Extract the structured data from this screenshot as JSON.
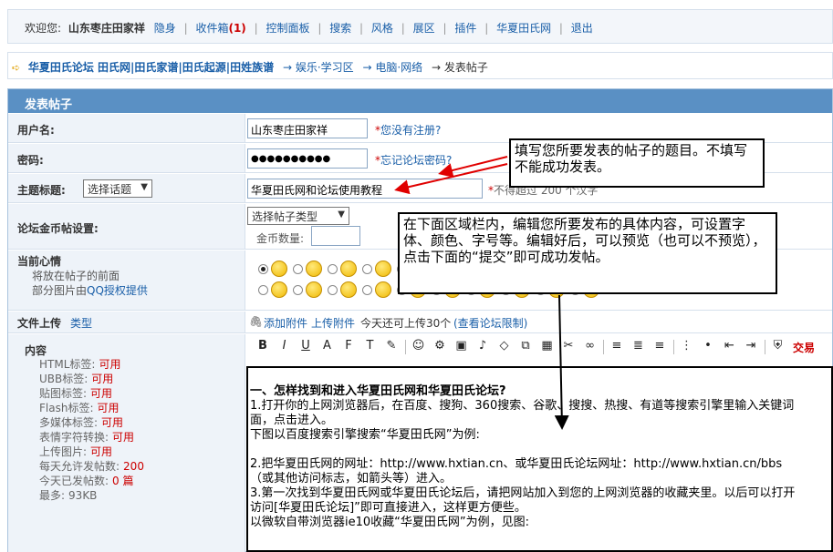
{
  "userbar": {
    "welcome": "欢迎您:",
    "username": "山东枣庄田家祥",
    "links": [
      "隐身",
      "收件箱",
      "控制面板",
      "搜索",
      "风格",
      "展区",
      "插件",
      "华夏田氏网",
      "退出"
    ],
    "inbox_count": "(1)"
  },
  "breadcrumb": {
    "forum": "华夏田氏论坛 田氏网|田氏家谱|田氏起源|田姓族谱",
    "path": [
      "→ 娱乐·学习区",
      "→ 电脑·网络",
      "→ 发表帖子"
    ]
  },
  "form": {
    "title": "发表帖子",
    "username_label": "用户名:",
    "username_value": "山东枣庄田家祥",
    "register_hint": "您没有注册?",
    "password_label": "密码:",
    "password_value": "●●●●●●●●●●",
    "forgot_hint": "忘记论坛密码?",
    "subject_label": "主题标题:",
    "topic_select": "选择话题",
    "subject_value": "华夏田氏网和论坛使用教程",
    "subject_hint": "不得超过 200 个汉字",
    "coin_label": "论坛金币帖设置:",
    "post_type_select": "选择帖子类型",
    "coin_amount_label": "金币数量:",
    "mood_label": "当前心情",
    "mood_sub1": "将放在帖子的前面",
    "mood_sub2_prefix": "部分图片由",
    "mood_sub2_link": "QQ授权提供",
    "upload_label": "文件上传",
    "upload_type": "类型",
    "add_attach": "添加附件",
    "upload_attach": "上传附件",
    "upload_quota": "今天还可上传30个",
    "view_limit": "(查看论坛限制)",
    "content_label": "内容",
    "content_rules": [
      {
        "k": "HTML标签:",
        "v": "可用"
      },
      {
        "k": "UBB标签:",
        "v": "可用"
      },
      {
        "k": "贴图标签:",
        "v": "可用"
      },
      {
        "k": "Flash标签:",
        "v": "可用"
      },
      {
        "k": "多媒体标签:",
        "v": "可用"
      },
      {
        "k": "表情字符转换:",
        "v": "可用"
      },
      {
        "k": "上传图片:",
        "v": "可用"
      },
      {
        "k": "每天允许发帖数:",
        "v": "200"
      },
      {
        "k": "今天已发帖数:",
        "v": "0 篇"
      },
      {
        "k": "最多:",
        "v": "93KB"
      }
    ],
    "toolbar_trade": "交易"
  },
  "editor": {
    "lines": [
      "一、怎样找到和进入华夏田氏网和华夏田氏论坛?",
      "1.打开你的上网浏览器后，在百度、搜狗、360搜索、谷歌、搜搜、热搜、有道等搜索引擎里输入关键词",
      "面，点击进入。",
      "下图以百度搜索引擎搜索“华夏田氏网”为例:",
      "",
      "2.把华夏田氏网的网址：http://www.hxtian.cn、或华夏田氏论坛网址：http://www.hxtian.cn/bbs",
      "（或其他访问标志，如箭头等）进入。",
      "3.第一次找到华夏田氏网或华夏田氏论坛后，请把网站加入到您的上网浏览器的收藏夹里。以后可以打开",
      "访问[华夏田氏论坛]”即可直接进入，这样更方便些。",
      "以微软自带浏览器ie10收藏“华夏田氏网”为例，见图:"
    ]
  },
  "callouts": {
    "title_tip": "填写您所要发表的帖子的题目。不填写不能成功发表。",
    "content_tip": "在下面区域栏内，编辑您所要发布的具体内容，可设置字体、颜色、字号等。编辑好后，可以预览（也可以不预览），点击下面的“提交”即可成功发帖。"
  },
  "colors": {
    "header": "#5a90c4",
    "link": "#1a5fa8",
    "arrow": "#e00000"
  }
}
